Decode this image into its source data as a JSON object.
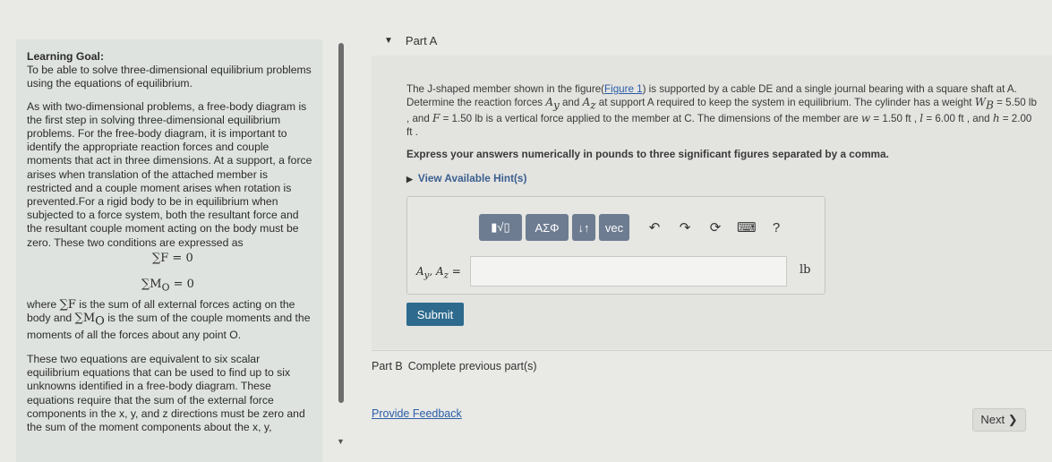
{
  "learning_goal": {
    "title": "Learning Goal:",
    "p1": "To be able to solve three-dimensional equilibrium problems using the equations of equilibrium.",
    "p2": "As with two-dimensional problems, a free-body diagram is the first step in solving three-dimensional equilibrium problems. For the free-body diagram, it is important to identify the appropriate reaction forces and couple moments that act in three dimensions. At a support, a force arises when translation of the attached member is restricted and a couple moment arises when rotation is prevented.For a rigid body to be in equilibrium when subjected to a force system, both the resultant force and the resultant couple moment acting on the body must be zero. These two conditions are expressed as",
    "eq1": "∑F = 0",
    "eq2": "∑M",
    "eq2_sub": "O",
    "eq2_rest": " = 0",
    "where_1": "where ",
    "where_sym1": "∑F",
    "where_2": " is the sum of all external forces acting on the body and ",
    "where_sym2": "∑M",
    "where_sym2_sub": "O",
    "where_3": " is the sum of the couple moments and the moments of all the forces about any point O.",
    "p4": "These two equations are equivalent to six scalar equilibrium equations that can be used to find up to six unknowns identified in a free-body diagram. These equations require that the sum of the external force components in the x, y, and z directions must be zero and the sum of the moment components about the x, y,"
  },
  "part_a": {
    "label": "Part A",
    "problem_1": "The J-shaped member shown in the figure(",
    "figure_link": "Figure 1",
    "problem_2": ") is supported by a cable DE and a single journal bearing with a square shaft at A. Determine the reaction forces ",
    "ay": "A",
    "ay_sub": "y",
    "and_text": " and ",
    "az": "A",
    "az_sub": "z",
    "problem_3": " at support A required to keep the system in equilibrium. The cylinder has a weight ",
    "wb": "W",
    "wb_sub": "B",
    "wb_val": " = 5.50 lb",
    "problem_4": " , and ",
    "f_sym": "F",
    "f_val": " = 1.50 lb",
    "problem_5": " is a vertical force applied to the member at C. The dimensions of the member are ",
    "w_sym": "w",
    "w_val": " = 1.50 ft",
    "problem_6": " , ",
    "l_sym": "l",
    "l_val": " = 6.00 ft",
    "problem_7": " , and ",
    "h_sym": "h",
    "h_val": " = 2.00 ft",
    "problem_8": " .",
    "express": "Express your answers numerically in pounds to three significant figures separated by a comma.",
    "hints": "View Available Hint(s)",
    "toolbar": {
      "templates": "▮√▯",
      "greek": "ΑΣΦ",
      "arrows": "↓↑",
      "vec": "vec",
      "undo": "↶",
      "redo": "↷",
      "reset": "⟳",
      "keyboard": "⌨",
      "help": "?"
    },
    "answer_label": "A",
    "answer_label_sub1": "y",
    "answer_label_mid": ", A",
    "answer_label_sub2": "z",
    "answer_label_end": " =",
    "answer_value": "",
    "unit": "lb",
    "submit": "Submit"
  },
  "part_b": {
    "label": "Part B",
    "text": "Complete previous part(s)"
  },
  "footer": {
    "feedback": "Provide Feedback",
    "next": "Next ❯"
  }
}
